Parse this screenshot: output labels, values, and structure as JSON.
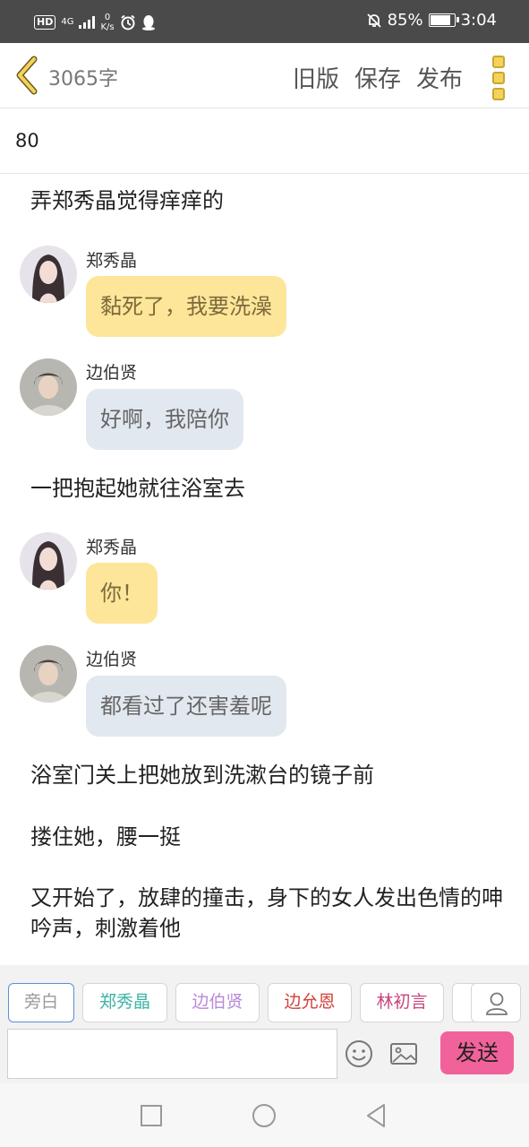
{
  "statusbar": {
    "hd": "HD",
    "network": "4G",
    "speed_value": "0",
    "speed_unit": "K/s",
    "battery_percent": "85%",
    "battery_level": 0.85,
    "time": "3:04"
  },
  "toolbar": {
    "word_count": "3065字",
    "old_version": "旧版",
    "save": "保存",
    "publish": "发布"
  },
  "title": "80",
  "content": {
    "narration_1": "弄郑秀晶觉得痒痒的",
    "msg_1": {
      "speaker": "郑秀晶",
      "text": "黏死了，我要洗澡"
    },
    "msg_2": {
      "speaker": "边伯贤",
      "text": "好啊，我陪你"
    },
    "narration_2": "一把抱起她就往浴室去",
    "msg_3": {
      "speaker": "郑秀晶",
      "text": "你！"
    },
    "msg_4": {
      "speaker": "边伯贤",
      "text": "都看过了还害羞呢"
    },
    "narration_3": "浴室门关上把她放到洗漱台的镜子前",
    "narration_4": "搂住她，腰一挺",
    "narration_5": "又开始了，放肆的撞击，身下的女人发出色情的呻吟声，刺激着他"
  },
  "composer": {
    "chips": [
      {
        "label": "旁白",
        "color": "#9a9a9a"
      },
      {
        "label": "郑秀晶",
        "color": "#3bb3a3"
      },
      {
        "label": "边伯贤",
        "color": "#b98ad6"
      },
      {
        "label": "边允恩",
        "color": "#d0433c"
      },
      {
        "label": "林初言",
        "color": "#c8457d"
      }
    ],
    "input_value": "",
    "send": "发送"
  },
  "colors": {
    "accent_pink": "#f2629a",
    "bubble_yellow": "#fde69a",
    "bubble_grey": "#e2e8ef",
    "icon_yellow": "#f3d35a"
  },
  "icons": [
    "back-chevron-icon",
    "menu-dots-icon",
    "emoji-icon",
    "image-icon",
    "user-icon",
    "square-icon",
    "circle-icon",
    "triangle-back-icon"
  ]
}
